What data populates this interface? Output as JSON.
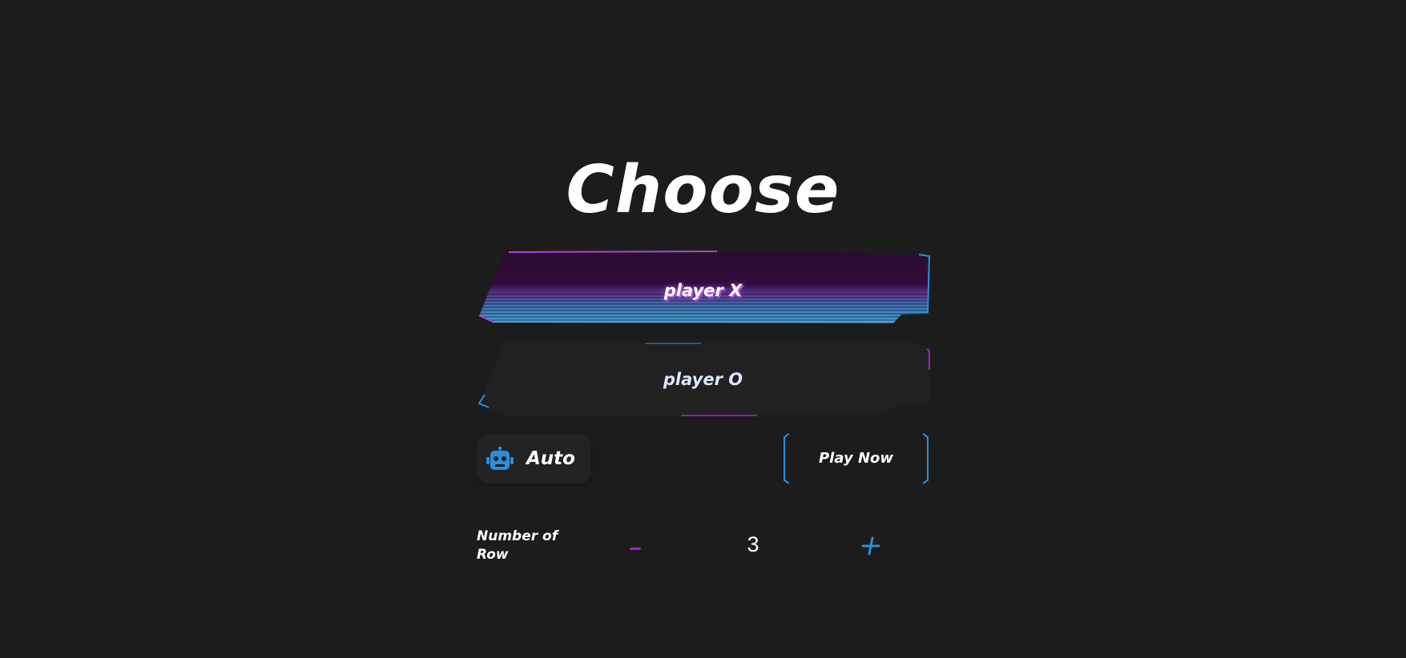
{
  "title": "Choose",
  "players": [
    {
      "label": "player X",
      "selected": true
    },
    {
      "label": "player O",
      "selected": false
    }
  ],
  "auto": {
    "label": "Auto",
    "icon": "robot-icon"
  },
  "play": {
    "label": "Play Now"
  },
  "rows": {
    "label": "Number of Row",
    "value": "3",
    "decrement_icon": "minus-icon",
    "increment_icon": "plus-icon"
  },
  "colors": {
    "background": "#1c1c1c",
    "accent_purple": "#a020c8",
    "accent_blue": "#2a8fd8",
    "card": "#212121"
  }
}
